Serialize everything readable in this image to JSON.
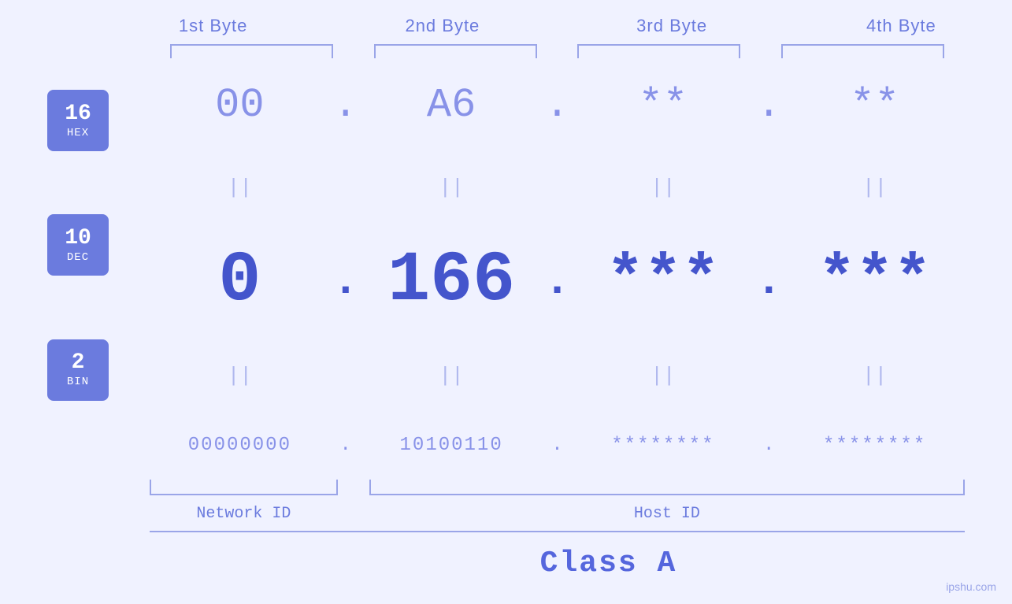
{
  "header": {
    "byte1": "1st Byte",
    "byte2": "2nd Byte",
    "byte3": "3rd Byte",
    "byte4": "4th Byte"
  },
  "badges": {
    "hex": {
      "number": "16",
      "label": "HEX"
    },
    "dec": {
      "number": "10",
      "label": "DEC"
    },
    "bin": {
      "number": "2",
      "label": "BIN"
    }
  },
  "hex_row": {
    "b1": "00",
    "b2": "A6",
    "b3": "**",
    "b4": "**",
    "dot": "."
  },
  "dec_row": {
    "b1": "0",
    "b2": "166.",
    "b3": "***.",
    "b4": "***",
    "dot": "."
  },
  "bin_row": {
    "b1": "00000000",
    "b2": "10100110",
    "b3": "********",
    "b4": "********",
    "dot": "."
  },
  "bottom": {
    "network_id": "Network ID",
    "host_id": "Host ID",
    "class": "Class A"
  },
  "watermark": "ipshu.com"
}
